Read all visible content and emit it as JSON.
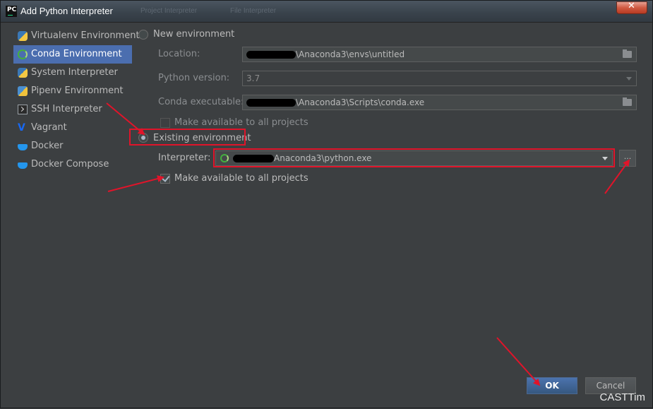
{
  "window": {
    "title": "Add Python Interpreter",
    "ghost_titles": [
      "Project Interpreter",
      "File Interpreter"
    ],
    "app_icon_text": "PC",
    "close_symbol": "✕"
  },
  "sidebar": {
    "items": [
      {
        "label": "Virtualenv Environment",
        "icon": "python-icon"
      },
      {
        "label": "Conda Environment",
        "icon": "conda-icon",
        "selected": true
      },
      {
        "label": "System Interpreter",
        "icon": "python-icon"
      },
      {
        "label": "Pipenv Environment",
        "icon": "pipenv-icon"
      },
      {
        "label": "SSH Interpreter",
        "icon": "terminal-icon"
      },
      {
        "label": "Vagrant",
        "icon": "vagrant-icon"
      },
      {
        "label": "Docker",
        "icon": "docker-icon"
      },
      {
        "label": "Docker Compose",
        "icon": "docker-icon"
      }
    ]
  },
  "new_env": {
    "radio_label": "New environment",
    "location_label": "Location:",
    "location_value": "\\Anaconda3\\envs\\untitled",
    "python_version_label": "Python version:",
    "python_version_value": "3.7",
    "conda_exec_label": "Conda executable:",
    "conda_exec_value": "\\Anaconda3\\Scripts\\conda.exe",
    "make_available_label": "Make available to all projects"
  },
  "existing_env": {
    "radio_label": "Existing environment",
    "interpreter_label": "Interpreter:",
    "interpreter_value": "Anaconda3\\python.exe",
    "browse_label": "...",
    "make_available_label": "Make available to all projects"
  },
  "footer": {
    "ok_label": "OK",
    "cancel_label": "Cancel"
  },
  "watermark": "CASTTim",
  "colors": {
    "background": "#3c3f41",
    "selection": "#4b6eaf",
    "annotation_red": "#e0142a",
    "conda_green": "#44b03f"
  }
}
